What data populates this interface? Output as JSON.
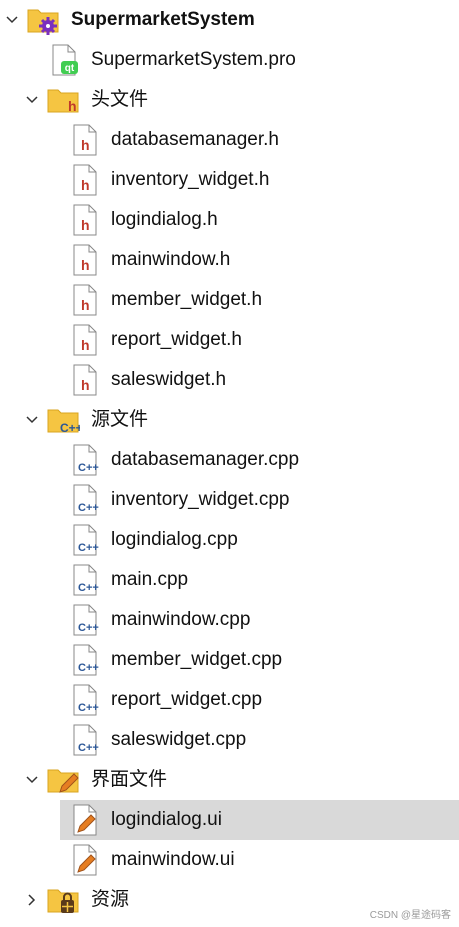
{
  "tree": {
    "root": {
      "label": "SupermarketSystem",
      "pro_file": "SupermarketSystem.pro"
    },
    "headers": {
      "label": "头文件",
      "files": [
        "databasemanager.h",
        "inventory_widget.h",
        "logindialog.h",
        "mainwindow.h",
        "member_widget.h",
        "report_widget.h",
        "saleswidget.h"
      ]
    },
    "sources": {
      "label": "源文件",
      "files": [
        "databasemanager.cpp",
        "inventory_widget.cpp",
        "logindialog.cpp",
        "main.cpp",
        "mainwindow.cpp",
        "member_widget.cpp",
        "report_widget.cpp",
        "saleswidget.cpp"
      ]
    },
    "forms": {
      "label": "界面文件",
      "files": [
        "logindialog.ui",
        "mainwindow.ui"
      ],
      "selected": "logindialog.ui"
    },
    "resources": {
      "label": "资源"
    }
  },
  "icon_text": {
    "qt": "qt",
    "h": "h",
    "cpp": "C++"
  },
  "colors": {
    "folder": "#f5c542",
    "header_h": "#c0392b",
    "cpp": "#2b5797",
    "pen": "#e67e22",
    "qt_green": "#41cd52",
    "gear": "#7b2fbe",
    "selection": "#d9d9d9"
  },
  "watermark": "CSDN @星途码客"
}
